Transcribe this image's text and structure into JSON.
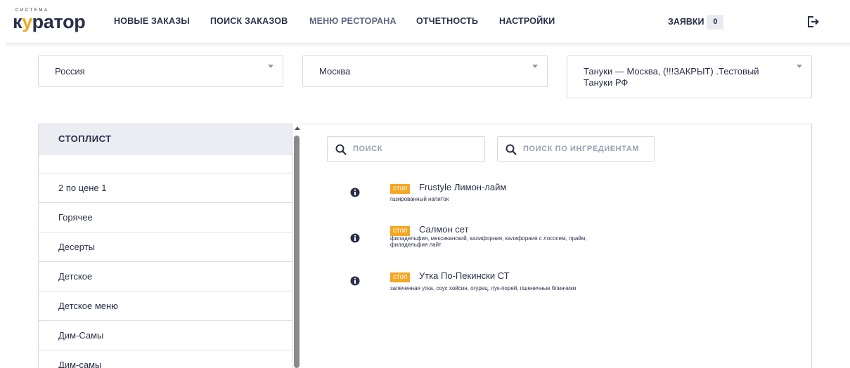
{
  "brand": {
    "small": "СИСТЕМА",
    "big_prefix": "к",
    "big_accent": "у",
    "big_suffix": "ратор"
  },
  "nav": {
    "new_orders": "НОВЫЕ ЗАКАЗЫ",
    "search_orders": "ПОИСК ЗАКАЗОВ",
    "restaurant_menu": "МЕНЮ РЕСТОРАНА",
    "reports": "ОТЧЕТНОСТЬ",
    "settings": "НАСТРОЙКИ",
    "requests_label": "ЗАЯВКИ",
    "requests_count": "0",
    "exit_icon": "logout-icon"
  },
  "filters": {
    "country": "Россия",
    "city": "Москва",
    "restaurant": "Тануки — Москва, (!!!ЗАКРЫТ) .Тестовый Тануки РФ"
  },
  "sidebar": {
    "title": "СТОПЛИСТ",
    "items": [
      "2 по цене 1",
      "Горячее",
      "Десерты",
      "Детское",
      "Детское меню",
      "Дим-Самы",
      "Дим-самы"
    ]
  },
  "search": {
    "placeholder": "ПОИСК",
    "ingredients_placeholder": "ПОИСК ПО ИНГРЕДИЕНТАМ"
  },
  "dishes": [
    {
      "badge": "стоп",
      "name": "Frustyle Лимон-лайм",
      "description": "газированный напиток"
    },
    {
      "badge": "стоп",
      "name": "Салмон сет",
      "description": "филадельфия, мексиканский, калифорния, калифорния с лососем, прайм, филадельфия лайт"
    },
    {
      "badge": "стоп",
      "name": "Утка По-Пекински СТ",
      "description": "запеченная утка, соус хойсин, огурец, лук-порей, пшеничные блинчики"
    }
  ],
  "colors": {
    "accent": "#f5a623",
    "text": "#2a2f4a",
    "border": "#d7d9e1",
    "panel_head": "#ebedf2"
  }
}
